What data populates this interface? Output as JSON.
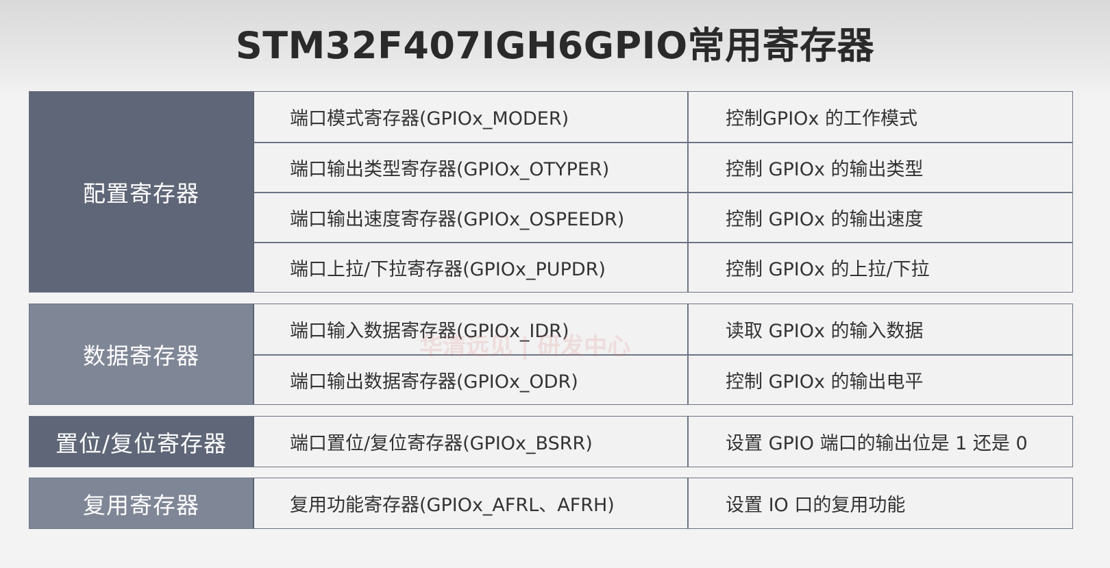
{
  "title": "STM32F407IGH6GPIO常用寄存器",
  "groups": [
    {
      "category": "配置寄存器",
      "rows": [
        {
          "register": "端口模式寄存器(GPIOx_MODER)",
          "description": "控制GPIOx 的工作模式"
        },
        {
          "register": "端口输出类型寄存器(GPIOx_OTYPER)",
          "description": "控制 GPIOx 的输出类型"
        },
        {
          "register": "端口输出速度寄存器(GPIOx_OSPEEDR)",
          "description": "控制 GPIOx 的输出速度"
        },
        {
          "register": "端口上拉/下拉寄存器(GPIOx_PUPDR)",
          "description": "控制 GPIOx 的上拉/下拉"
        }
      ]
    },
    {
      "category": "数据寄存器",
      "rows": [
        {
          "register": "端口输入数据寄存器(GPIOx_IDR)",
          "description": "读取 GPIOx 的输入数据"
        },
        {
          "register": "端口输出数据寄存器(GPIOx_ODR)",
          "description": "控制 GPIOx 的输出电平"
        }
      ]
    },
    {
      "category": "置位/复位寄存器",
      "rows": [
        {
          "register": "端口置位/复位寄存器(GPIOx_BSRR)",
          "description": "设置 GPIO 端口的输出位是 1 还是 0"
        }
      ]
    },
    {
      "category": "复用寄存器",
      "rows": [
        {
          "register": "复用功能寄存器(GPIOx_AFRL、AFRH)",
          "description": "设置 IO 口的复用功能"
        }
      ]
    }
  ],
  "watermark": "华清远见 | 研发中心"
}
